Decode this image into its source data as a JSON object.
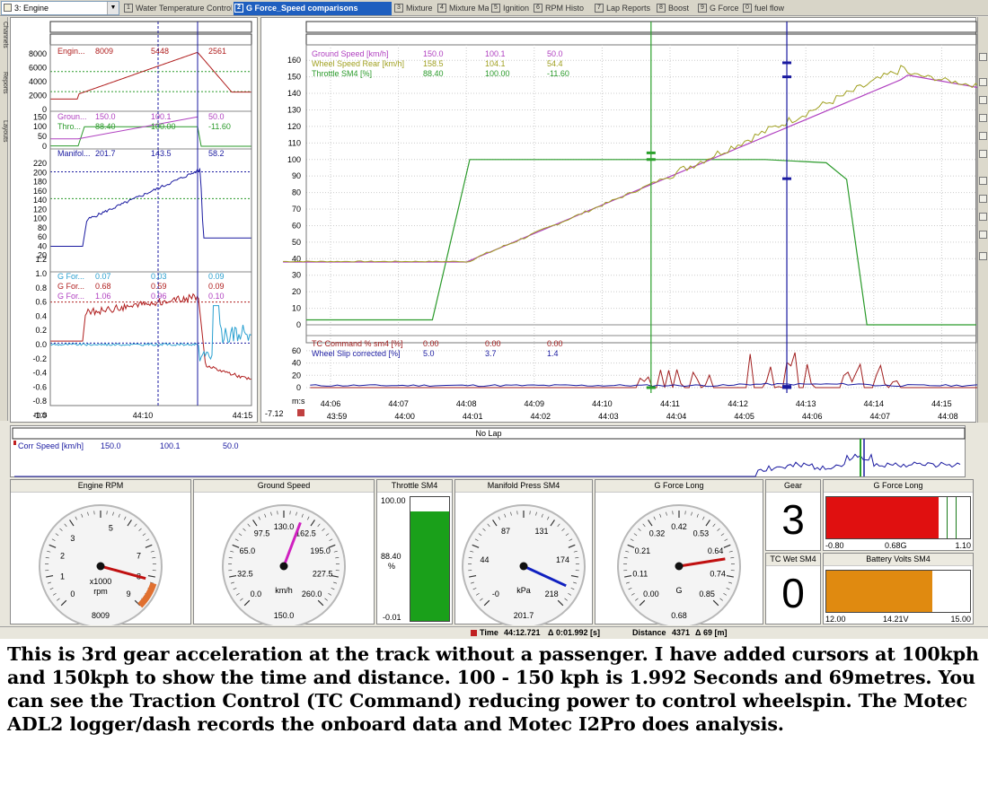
{
  "workspace": {
    "selected": "3: Engine"
  },
  "tabs": [
    {
      "num": "1",
      "label": "Water Temperature Control",
      "active": false
    },
    {
      "num": "2",
      "label": "G Force_Speed comparisons",
      "active": true
    },
    {
      "num": "3",
      "label": "Mixture",
      "active": false
    },
    {
      "num": "4",
      "label": "Mixture Map",
      "active": false
    },
    {
      "num": "5",
      "label": "Ignition",
      "active": false
    },
    {
      "num": "6",
      "label": "RPM Histo",
      "active": false
    },
    {
      "num": "7",
      "label": "Lap Reports",
      "active": false
    },
    {
      "num": "8",
      "label": "Boost",
      "active": false
    },
    {
      "num": "9",
      "label": "G Force",
      "active": false
    },
    {
      "num": "0",
      "label": "fuel flow",
      "active": false
    }
  ],
  "left_sidebar": [
    "Channels",
    "Reports",
    "Layouts"
  ],
  "left_graph": {
    "time_unit": "m:s",
    "time_ticks": [
      "44:10",
      "44:15"
    ],
    "panes": [
      {
        "name": "engine",
        "channel": "Engin...",
        "v1": "8009",
        "v2": "5448",
        "v3": "2561",
        "ticks": [
          "8000",
          "6000",
          "4000",
          "2000",
          "0"
        ],
        "color": "#b01e1e"
      },
      {
        "name": "ground",
        "channel": "Groun...",
        "v1": "150.0",
        "v2": "100.1",
        "v3": "50.0",
        "ticks": [
          "150",
          "100",
          "50",
          "0"
        ],
        "color": "#b040c0",
        "channel2": "Thro...",
        "w1": "88.40",
        "w2": "100.00",
        "w3": "-11.60",
        "color2": "#2a9a2a"
      },
      {
        "name": "manifold",
        "channel": "Manifol...",
        "v1": "201.7",
        "v2": "143.5",
        "v3": "58.2",
        "ticks": [
          "220",
          "200",
          "180",
          "160",
          "140",
          "120",
          "100",
          "80",
          "60",
          "40",
          "20"
        ],
        "color": "#1a1aa0"
      },
      {
        "name": "gforce",
        "channels": [
          {
            "label": "G For...",
            "v1": "0.07",
            "v2": "0.03",
            "v3": "0.09",
            "color": "#2aa0d0"
          },
          {
            "label": "G For...",
            "v1": "0.68",
            "v2": "0.59",
            "v3": "0.09",
            "color": "#b01e1e"
          },
          {
            "label": "G For...",
            "v1": "1.06",
            "v2": "0.96",
            "v3": "0.10",
            "color": "#b040c0"
          }
        ],
        "ticks": [
          "1.2",
          "1.0",
          "0.8",
          "0.6",
          "0.4",
          "0.2",
          "0.0",
          "-0.2",
          "-0.4",
          "-0.6",
          "-0.8",
          "-1.0"
        ]
      }
    ]
  },
  "main_graph": {
    "legend": [
      {
        "label": "Ground Speed [km/h]",
        "v1": "150.0",
        "v2": "100.1",
        "v3": "50.0",
        "color": "#b040c0"
      },
      {
        "label": "Wheel Speed Rear [km/h]",
        "v1": "158.5",
        "v2": "104.1",
        "v3": "54.4",
        "color": "#a0a020"
      },
      {
        "label": "Throttle SM4 [%]",
        "v1": "88.40",
        "v2": "100.00",
        "v3": "-11.60",
        "color": "#2a9a2a"
      }
    ],
    "ticks": [
      "160",
      "150",
      "140",
      "130",
      "120",
      "110",
      "100",
      "90",
      "80",
      "70",
      "60",
      "50",
      "40",
      "30",
      "20",
      "10",
      "0"
    ],
    "tc_legend": [
      {
        "label": "TC Command % sm4 [%]",
        "v1": "0.00",
        "v2": "0.00",
        "v3": "0.00",
        "color": "#a01e1e"
      },
      {
        "label": "Wheel Slip corrected [%]",
        "v1": "5.0",
        "v2": "3.7",
        "v3": "1.4",
        "color": "#1a1aa0"
      }
    ],
    "tc_ticks": [
      "60",
      "40",
      "20",
      "0"
    ],
    "time_unit": "m:s",
    "time_ticks": [
      "44:06",
      "44:07",
      "44:08",
      "44:09",
      "44:10",
      "44:11",
      "44:12",
      "44:13",
      "44:14",
      "44:15"
    ],
    "offset_label": "-7.12",
    "offset_ticks": [
      "43:59",
      "44:00",
      "44:01",
      "44:02",
      "44:03",
      "44:04",
      "44:05",
      "44:06",
      "44:07",
      "44:08"
    ]
  },
  "lap_strip": {
    "title": "No Lap",
    "channel": "Corr Speed [km/h]",
    "v1": "150.0",
    "v2": "100.1",
    "v3": "50.0"
  },
  "gauges": [
    {
      "title": "Engine RPM",
      "ticks": [
        "0",
        "1",
        "2",
        "3",
        "5",
        "7",
        "8",
        "9"
      ],
      "unit": "x1000",
      "unit2": "rpm",
      "value": "8009"
    },
    {
      "title": "Ground Speed",
      "ticks": [
        "0.0",
        "32.5",
        "65.0",
        "97.5",
        "130.0",
        "162.5",
        "195.0",
        "227.5",
        "260.0"
      ],
      "unit": "km/h",
      "value": "150.0"
    },
    {
      "title": "Manifold Press SM4",
      "ticks": [
        "-0",
        "44",
        "87",
        "131",
        "174",
        "218"
      ],
      "unit": "kPa",
      "value": "201.7"
    },
    {
      "title": "G Force Long",
      "ticks": [
        "0.00",
        "0.11",
        "0.21",
        "0.32",
        "0.42",
        "0.53",
        "0.64",
        "0.74",
        "0.85"
      ],
      "unit": "G",
      "value": "0.68"
    }
  ],
  "throttle_bar": {
    "title": "Throttle SM4",
    "max": "100.00",
    "value": "88.40",
    "unit": "%",
    "min": "-0.01",
    "fraction": 0.884
  },
  "gear": {
    "title": "Gear",
    "value": "3"
  },
  "tc_wet": {
    "title": "TC Wet SM4",
    "value": "0"
  },
  "g_force_bar": {
    "title": "G Force Long",
    "min": "-0.80",
    "value": "0.68G",
    "max": "1.10",
    "fraction": 0.78
  },
  "battery_bar": {
    "title": "Battery Volts SM4",
    "min": "12.00",
    "value": "14.21V",
    "max": "15.00",
    "fraction": 0.74
  },
  "status": {
    "time_label": "Time",
    "time_value": "44:12.721",
    "time_delta": "Δ 0:01.992 [s]",
    "dist_label": "Distance",
    "dist_value": "4371",
    "dist_delta": "Δ 69 [m]"
  },
  "caption": "This is 3rd gear acceleration at the track without a passenger. I have added cursors at 100kph and 150kph to show the time and distance. 100 - 150 kph is 1.992 Seconds and 69metres. You can see the Traction Control (TC Command) reducing power to control wheelspin. The Motec ADL2 logger/dash records the onboard data and Motec I2Pro does analysis.",
  "colors": {
    "accent_tab": "#1f5fbf",
    "cursor_green": "#2aa02a",
    "cursor_blue": "#1a1aa0"
  }
}
